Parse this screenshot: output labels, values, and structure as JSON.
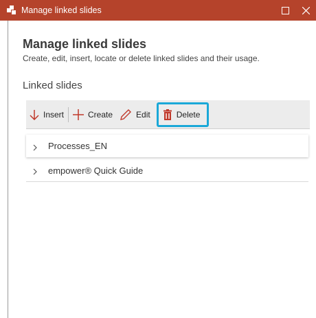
{
  "window": {
    "title": "Manage linked slides",
    "titlebar_color": "#b5432b"
  },
  "header": {
    "title": "Manage linked slides",
    "subtitle": "Create, edit, insert, locate or delete linked slides and their usage."
  },
  "section": {
    "label": "Linked slides"
  },
  "toolbar": {
    "insert_label": "Insert",
    "create_label": "Create",
    "edit_label": "Edit",
    "delete_label": "Delete",
    "icon_color": "#c0392b",
    "highlight_color": "#1aa8d8"
  },
  "list": {
    "items": [
      {
        "label": "Processes_EN",
        "icon": "chevron-right-icon"
      },
      {
        "label": "empower® Quick Guide",
        "icon": "chevron-right-icon"
      }
    ]
  }
}
